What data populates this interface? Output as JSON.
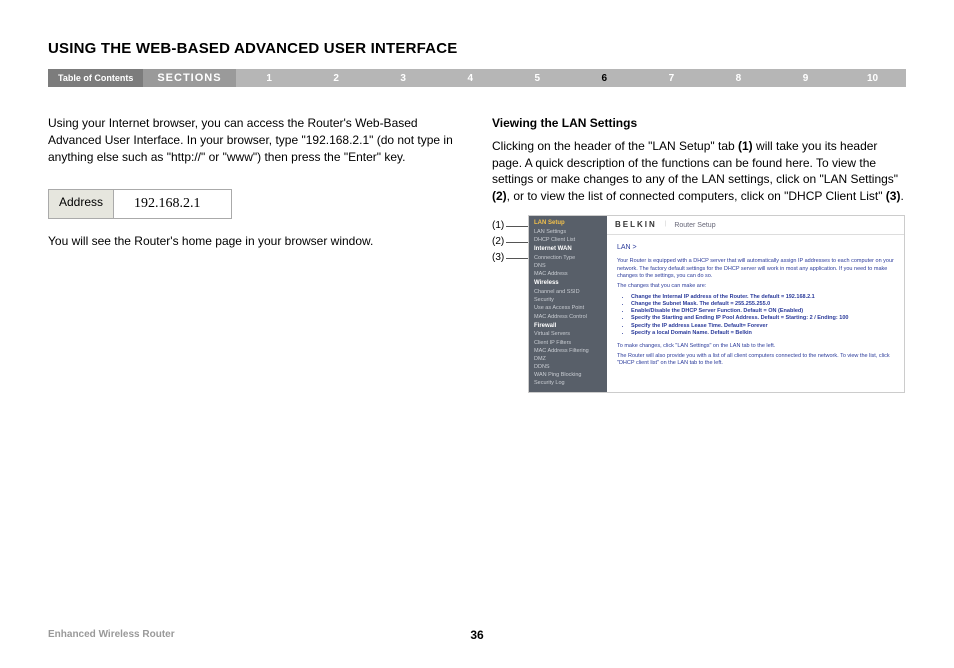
{
  "title": "USING THE WEB-BASED ADVANCED USER INTERFACE",
  "navbar": {
    "toc": "Table of Contents",
    "sections": "SECTIONS",
    "nums": [
      "1",
      "2",
      "3",
      "4",
      "5",
      "6",
      "7",
      "8",
      "9",
      "10"
    ],
    "active": "6"
  },
  "left": {
    "p1": "Using your Internet browser, you can access the Router's Web-Based Advanced User Interface. In your browser, type \"192.168.2.1\" (do not type in anything else such as \"http://\" or \"www\") then press the \"Enter\" key.",
    "address_label": "Address",
    "address_value": "192.168.2.1",
    "p2": "You will see the Router's home page in your browser window."
  },
  "right": {
    "heading": "Viewing the LAN Settings",
    "p1a": "Clicking on the header of the \"LAN Setup\" tab ",
    "p1b": "(1)",
    "p1c": " will take you its header page. A quick description of the functions can be found here. To view the settings or make changes to any of the LAN settings, click on \"LAN Settings\" ",
    "p1d": "(2)",
    "p1e": ", or to view the list of connected computers, click on \"DHCP Client List\" ",
    "p1f": "(3)",
    "p1g": "."
  },
  "callouts": [
    "(1)",
    "(2)",
    "(3)"
  ],
  "figure": {
    "brand": "BELKIN",
    "subtitle": "Router Setup",
    "side": {
      "g1_hdr": "LAN Setup",
      "g1_items": [
        "LAN Settings",
        "DHCP Client List"
      ],
      "g2_hdr": "Internet WAN",
      "g2_items": [
        "Connection Type",
        "DNS",
        "MAC Address"
      ],
      "g3_hdr": "Wireless",
      "g3_items": [
        "Channel and SSID",
        "Security",
        "Use as Access Point",
        "MAC Address Control"
      ],
      "g4_hdr": "Firewall",
      "g4_items": [
        "Virtual Servers",
        "Client IP Filters",
        "MAC Address Filtering",
        "DMZ",
        "DDNS",
        "WAN Ping Blocking",
        "Security Log"
      ]
    },
    "body": {
      "lan": "LAN >",
      "intro": "Your Router is equipped with a DHCP server that will automatically assign IP addresses to each computer on your network. The factory default settings for the DHCP server will work in most any application. If you need to make changes to the settings, you can do so.",
      "changes": "The changes that you can make are:",
      "bullets": [
        "Change the Internal IP address of the Router. The default = 192.168.2.1",
        "Change the Subnet Mask. The default = 255.255.255.0",
        "Enable/Disable the DHCP Server Function. Default = ON (Enabled)",
        "Specify the Starting and Ending IP Pool Address. Default = Starting: 2 / Ending: 100",
        "Specify the IP address Lease Time. Default= Forever",
        "Specify a local Domain Name. Default = Belkin"
      ],
      "note1": "To make changes, click \"LAN Settings\" on the LAN tab to the left.",
      "note2": "The Router will also provide you with a list of all client computers connected to the network. To view the list, click \"DHCP client list\" on the LAN tab to the left."
    }
  },
  "footer": {
    "product": "Enhanced Wireless Router",
    "page": "36"
  }
}
